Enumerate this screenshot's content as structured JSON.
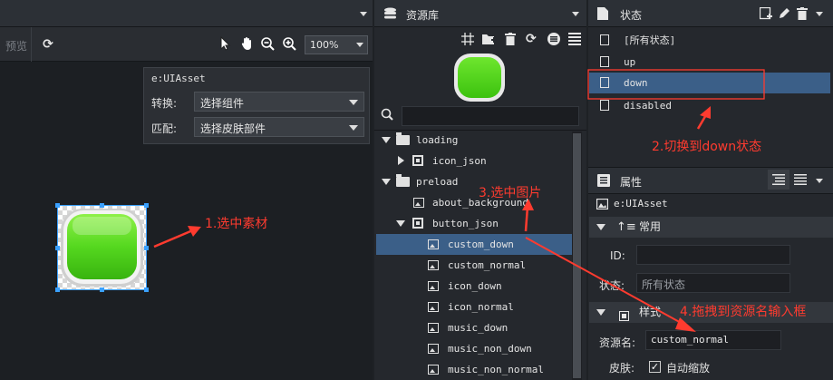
{
  "left_panel": {
    "toolbar": {
      "preview_label": "预览",
      "zoom_value": "100%"
    },
    "popup": {
      "title": "e:UIAsset",
      "rows": [
        {
          "label": "转换:",
          "value": "选择组件"
        },
        {
          "label": "匹配:",
          "value": "选择皮肤部件"
        }
      ]
    }
  },
  "resource_panel": {
    "tab_label": "资源库",
    "tree": [
      {
        "label": "loading",
        "type": "folder",
        "expanded": true
      },
      {
        "label": "icon_json",
        "type": "json",
        "expanded": false
      },
      {
        "label": "preload",
        "type": "folder",
        "expanded": true
      },
      {
        "label": "about_background",
        "type": "image"
      },
      {
        "label": "button_json",
        "type": "json",
        "expanded": true
      },
      {
        "label": "custom_down",
        "type": "image",
        "selected": true
      },
      {
        "label": "custom_normal",
        "type": "image"
      },
      {
        "label": "icon_down",
        "type": "image"
      },
      {
        "label": "icon_normal",
        "type": "image"
      },
      {
        "label": "music_down",
        "type": "image"
      },
      {
        "label": "music_non_down",
        "type": "image"
      },
      {
        "label": "music_non_normal",
        "type": "image"
      }
    ]
  },
  "state_panel": {
    "tab_label": "状态",
    "states": [
      {
        "label": "[所有状态]"
      },
      {
        "label": "up"
      },
      {
        "label": "down",
        "selected": true
      },
      {
        "label": "disabled"
      }
    ]
  },
  "properties_panel": {
    "tab_label": "属性",
    "component_name": "e:UIAsset",
    "section_common": "常用",
    "id_label": "ID:",
    "id_value": "",
    "state_label": "状态:",
    "state_placeholder": "所有状态",
    "section_style": "样式",
    "resource_name_label": "资源名:",
    "resource_name_value": "custom_normal",
    "skin_label": "皮肤:",
    "auto_scale_label": "自动缩放",
    "auto_scale_checked": true
  },
  "annotations": {
    "step1": "1.选中素材",
    "step2": "2.切换到down状态",
    "step3": "3.选中图片",
    "step4": "4.拖拽到资源名输入框"
  },
  "colors": {
    "selection": "#3b5f88",
    "annotation": "#ff3b2f",
    "button_green": "#4cd619"
  }
}
